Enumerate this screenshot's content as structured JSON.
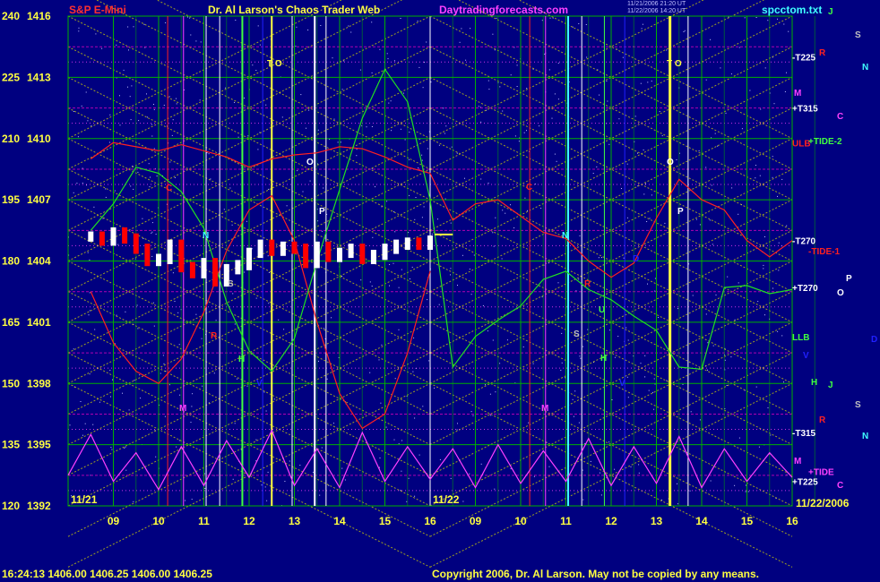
{
  "header": {
    "left": "S&P E-Mini",
    "middle": "Dr. Al Larson's Chaos Trader Web",
    "site": "Daytradingforecasts.com",
    "file": "spcctom.txt",
    "timestamps": [
      "11/21/2006 21:20 UT",
      "11/22/2006 14:20 UT"
    ]
  },
  "footer": {
    "quote": "16:24:13  1406.00  1406.25  1406.00  1406.25",
    "copyright": "Copyright 2006, Dr. Al Larson. May not be copied by any means.",
    "date": "11/22/2006"
  },
  "colors": {
    "background": "#000080",
    "header_red": "#ff3030",
    "header_yellow": "#ffff40",
    "site_magenta": "#ff40ff",
    "file_cyan": "#40ffff",
    "white": "#ffffff",
    "grid_green": "#00c000",
    "field_yellow": "#e0e000",
    "price_white": "#ffffff",
    "price_red": "#ff0000",
    "flux_red": "#ff2020",
    "flux_green": "#20e020",
    "flux_magenta": "#ff40ff"
  },
  "chart_data": {
    "type": "line",
    "title": "S&P E-Mini",
    "y_ticks": [
      {
        "left": "240",
        "right": "1416"
      },
      {
        "left": "225",
        "right": "1413"
      },
      {
        "left": "210",
        "right": "1410"
      },
      {
        "left": "195",
        "right": "1407"
      },
      {
        "left": "180",
        "right": "1404"
      },
      {
        "left": "165",
        "right": "1401"
      },
      {
        "left": "150",
        "right": "1398"
      },
      {
        "left": "135",
        "right": "1395"
      },
      {
        "left": "120",
        "right": "1392"
      }
    ],
    "ylim": [
      1392,
      1416
    ],
    "x_ticks": [
      "09",
      "10",
      "11",
      "12",
      "13",
      "14",
      "15",
      "16",
      "09",
      "10",
      "11",
      "12",
      "13",
      "14",
      "15",
      "16"
    ],
    "day_labels": [
      "11/21",
      "11/22"
    ],
    "price_series": {
      "name": "price",
      "x": [
        8.5,
        8.75,
        9.0,
        9.25,
        9.5,
        9.75,
        10.0,
        10.25,
        10.5,
        10.75,
        11.0,
        11.25,
        11.5,
        11.75,
        12.0,
        12.25,
        12.5,
        12.75,
        13.0,
        13.25,
        13.5,
        13.75,
        14.0,
        14.25,
        14.5,
        14.75,
        15.0,
        15.25,
        15.5,
        15.75,
        16.0
      ],
      "y": [
        1405.2,
        1405.0,
        1405.4,
        1405.1,
        1404.6,
        1404.0,
        1404.1,
        1404.8,
        1403.7,
        1403.4,
        1403.9,
        1403.0,
        1403.6,
        1403.8,
        1404.4,
        1404.8,
        1404.5,
        1404.7,
        1404.6,
        1403.9,
        1404.7,
        1404.2,
        1404.4,
        1404.6,
        1404.1,
        1404.3,
        1404.6,
        1404.8,
        1404.9,
        1404.8,
        1405.0
      ]
    },
    "flux_series": [
      {
        "name": "red",
        "x": [
          8.5,
          9.0,
          9.5,
          10.0,
          10.5,
          11.0,
          11.5,
          12.0,
          12.5,
          13.0,
          13.5,
          14.0,
          14.5,
          15.0,
          15.5,
          16.0,
          16.5,
          17.0,
          17.5,
          18.0,
          18.5,
          19.0,
          19.5,
          20.0,
          20.5,
          21.0,
          21.5,
          22.0,
          22.5,
          23.0,
          23.5,
          24.0
        ],
        "y": [
          1409.0,
          1409.8,
          1409.6,
          1409.4,
          1409.7,
          1409.4,
          1409.1,
          1408.6,
          1409.0,
          1409.2,
          1409.3,
          1409.6,
          1409.5,
          1409.1,
          1408.6,
          1408.3,
          1406.0,
          1406.8,
          1407.0,
          1406.2,
          1405.4,
          1405.1,
          1404.0,
          1403.2,
          1403.9,
          1406.1,
          1408.0,
          1407.0,
          1406.5,
          1405.0,
          1404.2,
          1405.0
        ]
      },
      {
        "name": "red-2",
        "x": [
          8.5,
          9.0,
          9.5,
          10.0,
          10.5,
          11.0,
          11.5,
          12.0,
          12.5,
          13.0,
          13.5,
          14.0,
          14.5,
          15.0,
          15.5,
          16.0
        ],
        "y": [
          1402.5,
          1400.0,
          1398.6,
          1398.0,
          1399.2,
          1401.5,
          1404.5,
          1406.5,
          1407.2,
          1405.0,
          1401.0,
          1397.5,
          1395.8,
          1396.5,
          1399.5,
          1403.5
        ]
      },
      {
        "name": "green",
        "x": [
          8.5,
          9.0,
          9.5,
          10.0,
          10.5,
          11.0,
          11.5,
          12.0,
          12.5,
          13.0,
          13.5,
          14.0,
          14.5,
          15.0,
          15.5,
          16.0,
          16.5,
          17.0,
          17.5,
          18.0,
          18.5,
          19.0,
          19.5,
          20.0,
          20.5,
          21.0,
          21.5,
          22.0,
          22.5,
          23.0,
          23.5,
          24.0
        ],
        "y": [
          1405.5,
          1406.8,
          1408.6,
          1408.3,
          1407.4,
          1405.6,
          1402.0,
          1399.6,
          1398.6,
          1400.2,
          1404.0,
          1407.5,
          1411.0,
          1413.4,
          1411.8,
          1407.0,
          1398.8,
          1400.3,
          1401.1,
          1401.8,
          1403.1,
          1403.5,
          1402.6,
          1402.1,
          1401.3,
          1400.6,
          1398.8,
          1398.7,
          1402.7,
          1402.8,
          1402.4,
          1402.6
        ]
      },
      {
        "name": "magenta",
        "x": [
          8.0,
          8.5,
          9.0,
          9.5,
          10.0,
          10.5,
          11.0,
          11.5,
          12.0,
          12.5,
          13.0,
          13.5,
          14.0,
          14.5,
          15.0,
          15.5,
          16.0,
          16.5,
          17.0,
          17.5,
          18.0,
          18.5,
          19.0,
          19.5,
          20.0,
          20.5,
          21.0,
          21.5,
          22.0,
          22.5,
          23.0,
          23.5,
          24.0
        ],
        "y": [
          1393.5,
          1395.5,
          1393.2,
          1394.6,
          1392.8,
          1394.9,
          1393.0,
          1395.2,
          1393.4,
          1395.7,
          1393.0,
          1394.8,
          1392.9,
          1395.6,
          1393.2,
          1394.9,
          1393.3,
          1394.8,
          1392.9,
          1395.0,
          1393.1,
          1394.7,
          1393.2,
          1395.3,
          1393.0,
          1394.9,
          1393.1,
          1395.4,
          1392.9,
          1394.8,
          1393.2,
          1394.6,
          1393.4
        ]
      }
    ],
    "line_labels": [
      {
        "text": "-T225",
        "color": "#ffffff"
      },
      {
        "text": "+T315",
        "color": "#ffffff"
      },
      {
        "text": "ULB",
        "color": "#ff2020"
      },
      {
        "text": "+TIDE-2",
        "color": "#40ff40"
      },
      {
        "text": "-T270",
        "color": "#ffffff"
      },
      {
        "text": "-TIDE-1",
        "color": "#ff2020"
      },
      {
        "text": "+T270",
        "color": "#ffffff"
      },
      {
        "text": "LLB",
        "color": "#40ff40"
      },
      {
        "text": "-T315",
        "color": "#ffffff"
      },
      {
        "text": "+TIDE",
        "color": "#ff40ff"
      },
      {
        "text": "+T225",
        "color": "#ffffff"
      }
    ],
    "planet_letters": [
      {
        "text": "J",
        "color": "#40ff40"
      },
      {
        "text": "S",
        "color": "#c0c0c0"
      },
      {
        "text": "R",
        "color": "#ff2020"
      },
      {
        "text": "N",
        "color": "#40ffff"
      },
      {
        "text": "M",
        "color": "#ff40ff"
      },
      {
        "text": "C",
        "color": "#ff40ff"
      },
      {
        "text": "O",
        "color": "#ffffff"
      },
      {
        "text": "P",
        "color": "#ffffff"
      },
      {
        "text": "D",
        "color": "#2020ff"
      },
      {
        "text": "V",
        "color": "#2020ff"
      },
      {
        "text": "H",
        "color": "#40ff40"
      },
      {
        "text": "J",
        "color": "#40ff40"
      },
      {
        "text": "S",
        "color": "#c0c0c0"
      },
      {
        "text": "R",
        "color": "#ff2020"
      },
      {
        "text": "N",
        "color": "#40ffff"
      },
      {
        "text": "M",
        "color": "#ff40ff"
      },
      {
        "text": "C",
        "color": "#ff40ff"
      }
    ],
    "chart_markers": [
      {
        "text": "C",
        "color": "#ff2020"
      },
      {
        "text": "N",
        "color": "#40ffff"
      },
      {
        "text": "M",
        "color": "#ff40ff"
      },
      {
        "text": "S",
        "color": "#c0c0c0"
      },
      {
        "text": "R",
        "color": "#ff2020"
      },
      {
        "text": "H",
        "color": "#40ff40"
      },
      {
        "text": "V",
        "color": "#2020ff"
      },
      {
        "text": "T O",
        "color": "#ffff40"
      },
      {
        "text": "O",
        "color": "#ffffff"
      },
      {
        "text": "P",
        "color": "#ffffff"
      },
      {
        "text": "C",
        "color": "#ff2020"
      },
      {
        "text": "N",
        "color": "#40ffff"
      },
      {
        "text": "M",
        "color": "#ff40ff"
      },
      {
        "text": "R",
        "color": "#ff2020"
      },
      {
        "text": "S",
        "color": "#c0c0c0"
      },
      {
        "text": "H",
        "color": "#40ff40"
      },
      {
        "text": "V",
        "color": "#2020ff"
      },
      {
        "text": "T O",
        "color": "#ffff40"
      },
      {
        "text": "O",
        "color": "#ffffff"
      },
      {
        "text": "P",
        "color": "#ffffff"
      },
      {
        "text": "U",
        "color": "#40ff40"
      },
      {
        "text": "D",
        "color": "#2020ff"
      }
    ]
  }
}
